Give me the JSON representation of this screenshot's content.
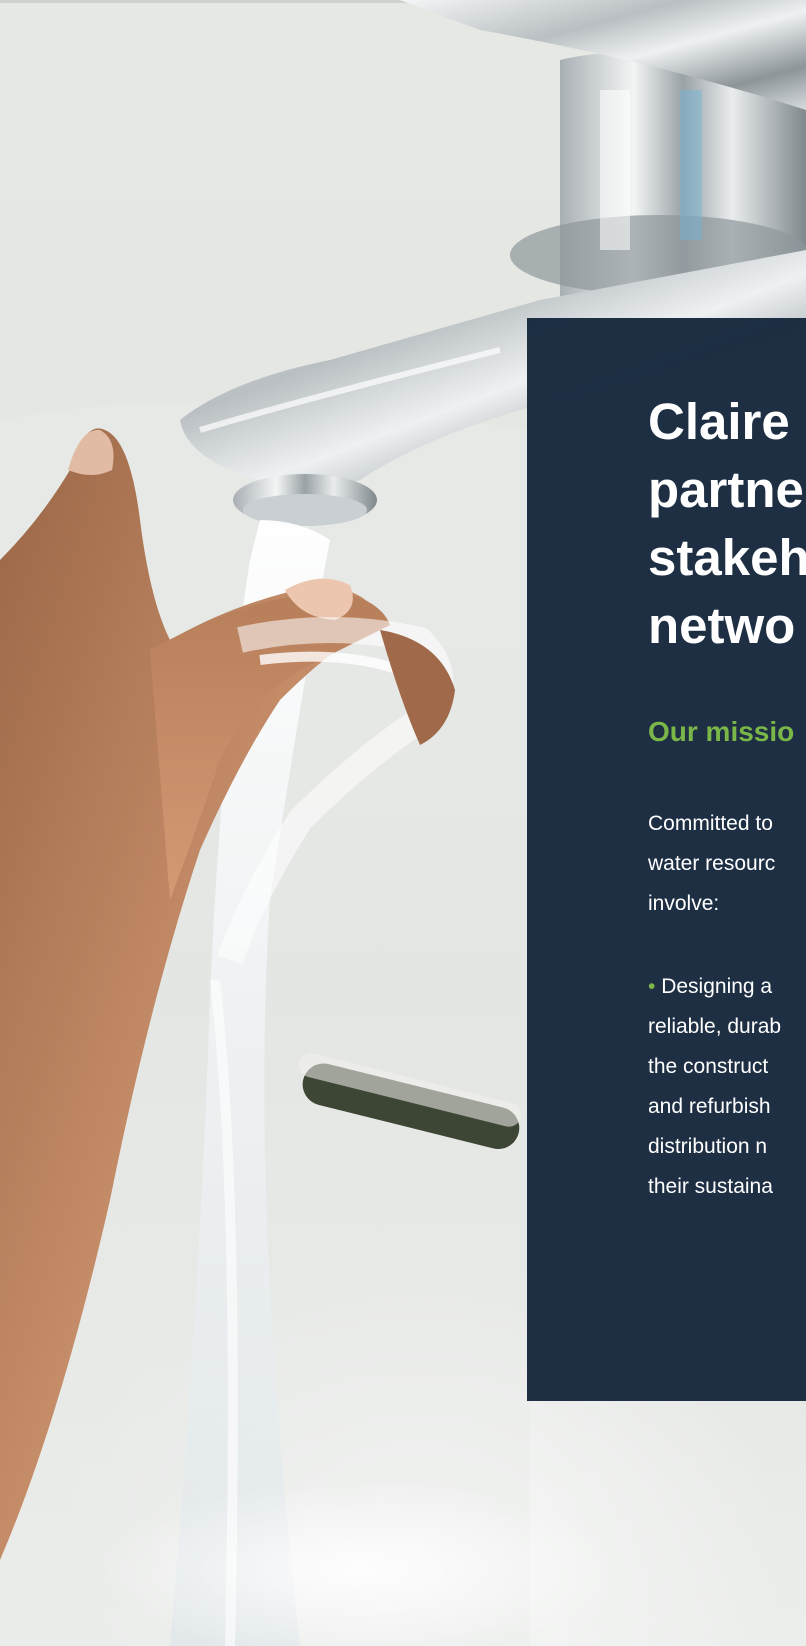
{
  "hero": {
    "image_alt": "Hands under running water from a chrome tap"
  },
  "panel": {
    "headline_lines": [
      "Claire",
      "partne",
      "stakeh",
      "netwo"
    ],
    "mission_heading": "Our missio",
    "intro_lines": [
      "Committed to",
      "water resourc",
      "involve:"
    ],
    "bullet_glyph": "•",
    "bullet_lines": [
      "Designing a",
      "reliable, durab",
      "the construct",
      "and refurbish",
      "distribution n",
      "their sustaina"
    ]
  },
  "colors": {
    "panel_bg": "#1a2b40",
    "accent_green": "#7ab648",
    "text": "#ffffff"
  }
}
